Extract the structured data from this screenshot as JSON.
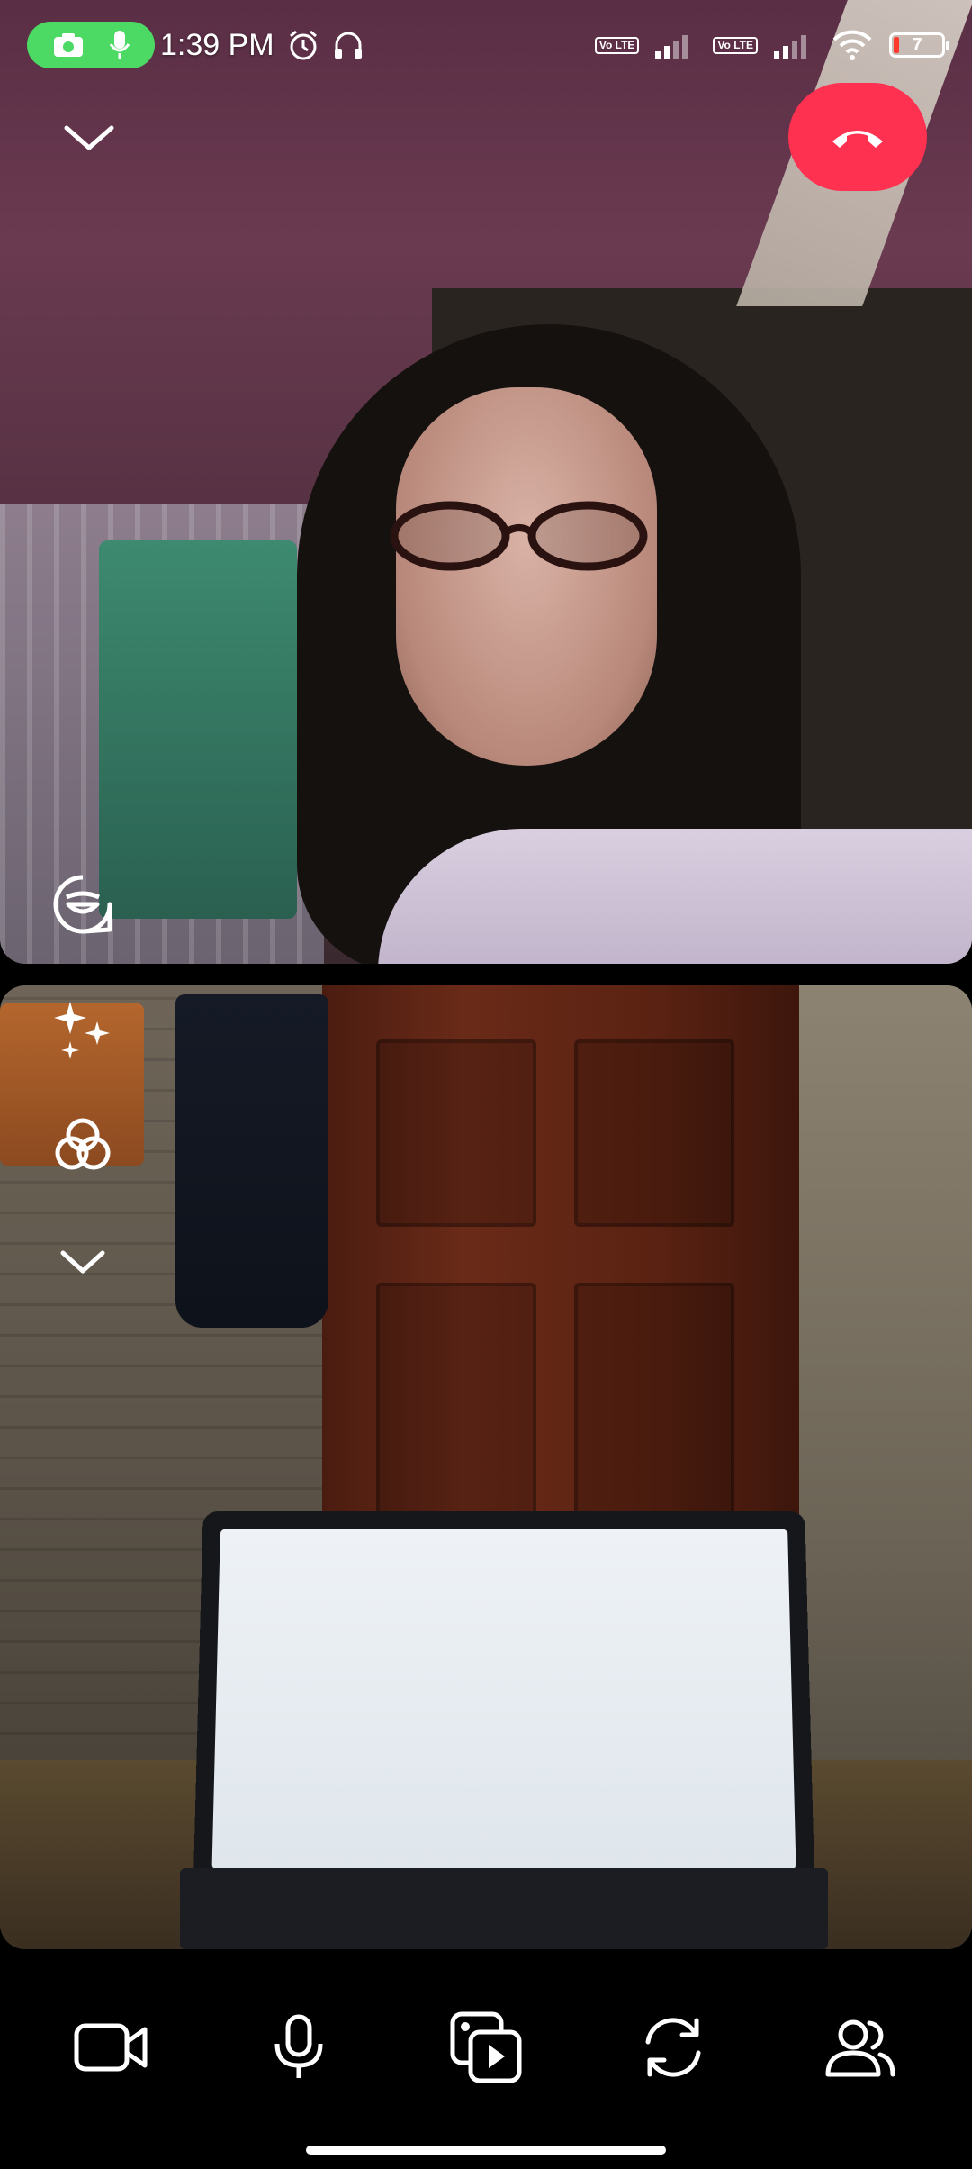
{
  "status_bar": {
    "time": "1:39 PM",
    "battery_level": "7",
    "network_badge_1": "Vo LTE",
    "network_badge_2": "Vo LTE",
    "active_indicator_color": "#4cd964"
  },
  "call": {
    "end_call_color": "#fe3150",
    "remote_video_label": "remote-participant-video",
    "local_video_label": "self-view-video"
  },
  "icons": {
    "minimize": "chevron-down-icon",
    "end_call": "phone-hangup-icon",
    "remote_overlay": "sticker-face-icon",
    "effects": "sparkles-icon",
    "filters": "filter-circles-icon",
    "collapse_tools": "chevron-down-icon",
    "camera": "video-camera-icon",
    "microphone": "microphone-icon",
    "share_media": "media-share-icon",
    "flip_camera": "flip-camera-icon",
    "participants": "participants-icon"
  }
}
